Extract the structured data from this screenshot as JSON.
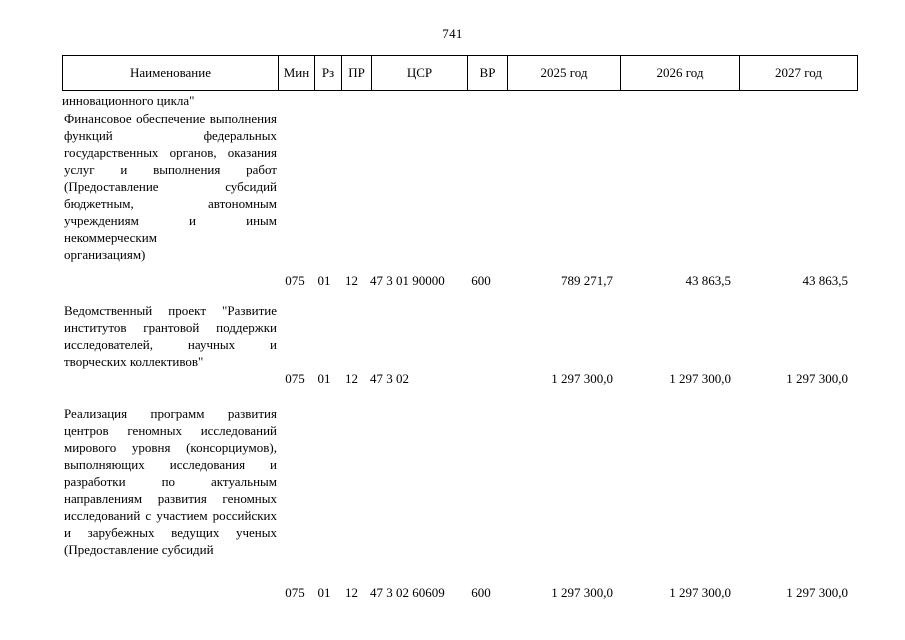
{
  "page": {
    "number": "741"
  },
  "table": {
    "columns": [
      {
        "key": "name",
        "label": "Наименование"
      },
      {
        "key": "min",
        "label": "Мин"
      },
      {
        "key": "rz",
        "label": "Рз"
      },
      {
        "key": "pr",
        "label": "ПР"
      },
      {
        "key": "csr",
        "label": "ЦСР"
      },
      {
        "key": "vr",
        "label": "ВР"
      },
      {
        "key": "y2025",
        "label": "2025 год"
      },
      {
        "key": "y2026",
        "label": "2026 год"
      },
      {
        "key": "y2027",
        "label": "2027 год"
      }
    ],
    "continued_text": "инновационного цикла\"",
    "rows": [
      {
        "name_lines": [
          "Финансовое обеспечение выполнения функций федеральных государственных органов, оказания услуг и выполнения работ (Предоставление субсидий бюджетным, автономным учреждениям и иным некоммерческим",
          "организациям)"
        ],
        "min": "075",
        "rz": "01",
        "pr": "12",
        "csr": "47 3 01 90000",
        "vr": "600",
        "y2025": "789 271,7",
        "y2026": "43 863,5",
        "y2027": "43 863,5"
      },
      {
        "name_lines": [
          "Ведомственный проект \"Развитие институтов грантовой поддержки исследователей, научных и",
          "творческих коллективов\""
        ],
        "min": "075",
        "rz": "01",
        "pr": "12",
        "csr": "47 3 02",
        "vr": "",
        "y2025": "1 297 300,0",
        "y2026": "1 297 300,0",
        "y2027": "1 297 300,0"
      },
      {
        "name_lines": [
          "Реализация программ развития центров геномных исследований мирового уровня (консорциумов), выполняющих исследования и разработки по актуальным направлениям развития геномных исследований с участием российских и зарубежных ведущих ученых",
          "(Предоставление субсидий"
        ],
        "min": "075",
        "rz": "01",
        "pr": "12",
        "csr": "47 3 02 60609",
        "vr": "600",
        "y2025": "1 297 300,0",
        "y2026": "1 297 300,0",
        "y2027": "1 297 300,0"
      }
    ]
  }
}
